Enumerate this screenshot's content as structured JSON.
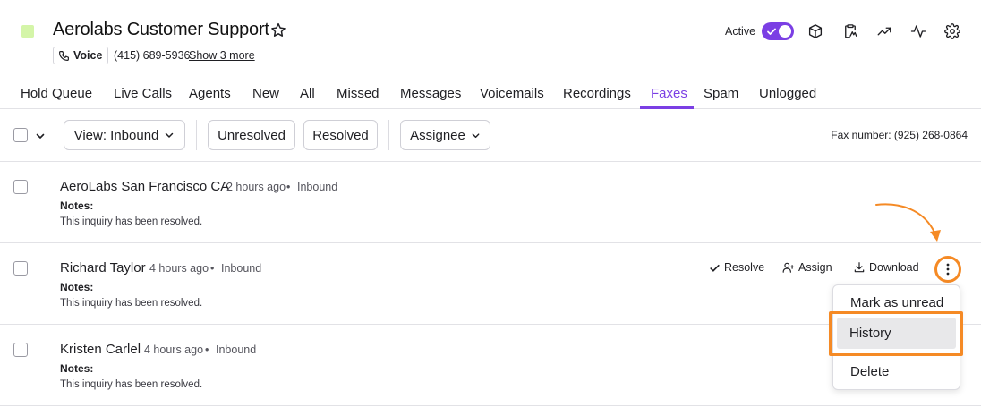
{
  "header": {
    "title": "Aerolabs Customer Support",
    "voice_label": "Voice",
    "phone": "(415) 689-5936",
    "show_more": "Show 3 more",
    "status_label": "Active",
    "logo_color": "#d4f5a8",
    "icons": [
      "cube-icon",
      "clipboard-icon",
      "trending-icon",
      "activity-icon",
      "gear-icon"
    ]
  },
  "tabs": [
    {
      "label": "Hold Queue"
    },
    {
      "label": "Live Calls"
    },
    {
      "label": "Agents"
    },
    {
      "label": "New"
    },
    {
      "label": "All"
    },
    {
      "label": "Missed"
    },
    {
      "label": "Messages"
    },
    {
      "label": "Voicemails"
    },
    {
      "label": "Recordings"
    },
    {
      "label": "Faxes",
      "active": true
    },
    {
      "label": "Spam"
    },
    {
      "label": "Unlogged"
    }
  ],
  "toolbar": {
    "view_label": "View: Inbound",
    "unresolved_label": "Unresolved",
    "resolved_label": "Resolved",
    "assignee_label": "Assignee",
    "fax_number": "Fax number: (925) 268-0864"
  },
  "rows": [
    {
      "name": "AeroLabs San Francisco CA",
      "time": "2 hours ago",
      "direction": "Inbound",
      "notes_label": "Notes:",
      "notes": "This inquiry has been resolved."
    },
    {
      "name": "Richard Taylor",
      "time": "4 hours ago",
      "direction": "Inbound",
      "notes_label": "Notes:",
      "notes": "This inquiry has been resolved."
    },
    {
      "name": "Kristen Carlel",
      "time": "4 hours ago",
      "direction": "Inbound",
      "notes_label": "Notes:",
      "notes": "This inquiry has been resolved."
    }
  ],
  "actions": {
    "resolve": "Resolve",
    "assign": "Assign",
    "download": "Download"
  },
  "menu": {
    "items": [
      "Mark as unread",
      "History",
      "Delete"
    ]
  },
  "colors": {
    "accent": "#7b3fe4",
    "highlight": "#f58a25"
  }
}
